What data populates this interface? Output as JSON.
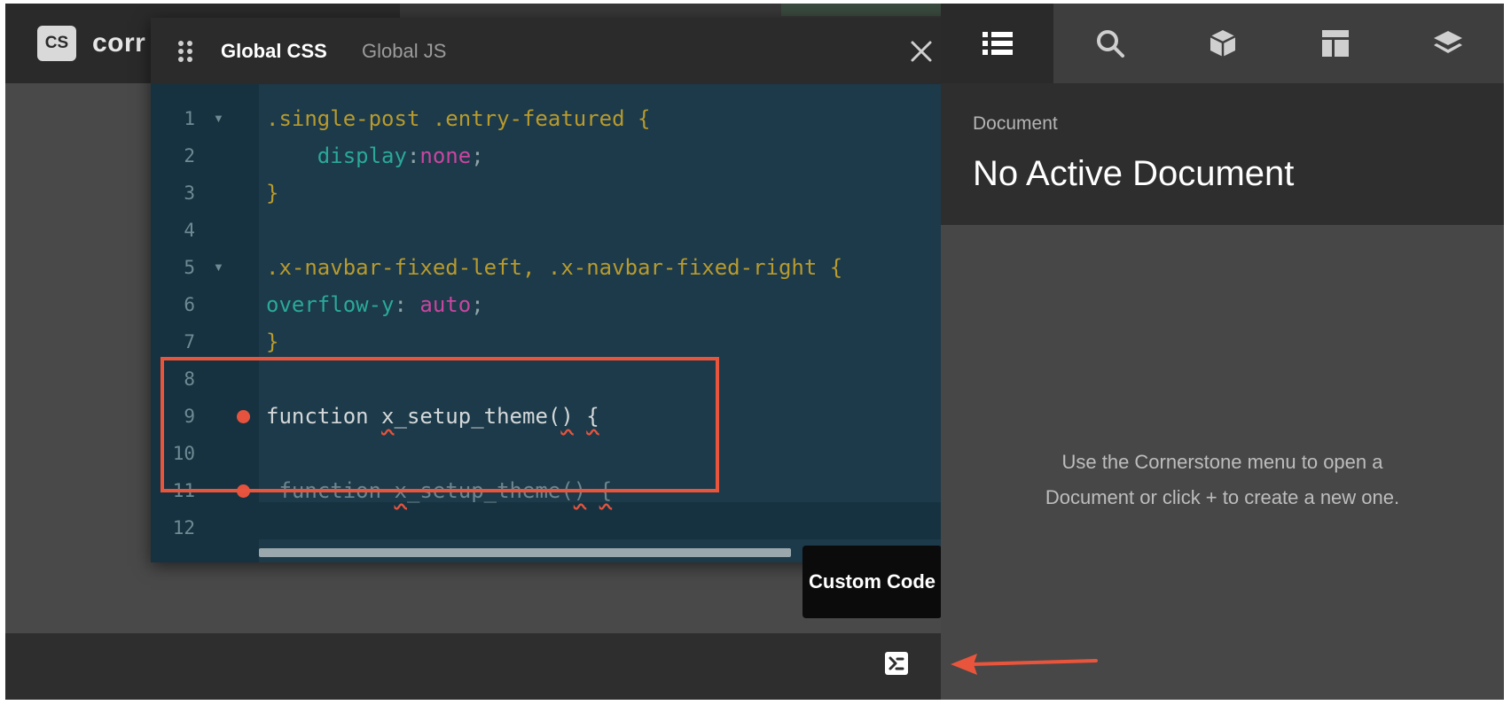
{
  "app": {
    "logo_text": "CS",
    "brand_text": "corr"
  },
  "editor": {
    "tabs": [
      {
        "label": "Global CSS",
        "active": true
      },
      {
        "label": "Global JS",
        "active": false
      }
    ],
    "lines": [
      {
        "n": "1",
        "fold": true,
        "parts": [
          {
            "t": ".single-post .entry-featured {",
            "c": "sel"
          }
        ]
      },
      {
        "n": "2",
        "parts": [
          {
            "t": "    display",
            "c": "prop"
          },
          {
            "t": ":",
            "c": "plain"
          },
          {
            "t": "none",
            "c": "val"
          },
          {
            "t": ";",
            "c": "plain"
          }
        ]
      },
      {
        "n": "3",
        "parts": [
          {
            "t": "}",
            "c": "sel"
          }
        ]
      },
      {
        "n": "4",
        "parts": []
      },
      {
        "n": "5",
        "fold": true,
        "parts": [
          {
            "t": ".x-navbar-fixed-left, .x-navbar-fixed-right {",
            "c": "sel"
          }
        ]
      },
      {
        "n": "6",
        "parts": [
          {
            "t": "overflow-y",
            "c": "prop"
          },
          {
            "t": ": ",
            "c": "plain"
          },
          {
            "t": "auto",
            "c": "val"
          },
          {
            "t": ";",
            "c": "plain"
          }
        ]
      },
      {
        "n": "7",
        "parts": [
          {
            "t": "}",
            "c": "sel"
          }
        ]
      },
      {
        "n": "8",
        "parts": []
      },
      {
        "n": "9",
        "error": true,
        "parts": [
          {
            "t": "function ",
            "c": "fn"
          },
          {
            "t": "x",
            "c": "fn squig"
          },
          {
            "t": "_setup_theme(",
            "c": "fn"
          },
          {
            "t": ")",
            "c": "fn squig"
          },
          {
            "t": " ",
            "c": "fn"
          },
          {
            "t": "{",
            "c": "fn squig"
          }
        ]
      },
      {
        "n": "10",
        "parts": []
      },
      {
        "n": "11",
        "error": true,
        "parts": [
          {
            "t": " function ",
            "c": "dim"
          },
          {
            "t": "x",
            "c": "dim squig"
          },
          {
            "t": "_setup_theme(",
            "c": "dim"
          },
          {
            "t": ")",
            "c": "dim squig"
          },
          {
            "t": " ",
            "c": "dim"
          },
          {
            "t": "{",
            "c": "dim squig"
          }
        ]
      },
      {
        "n": "12",
        "parts": []
      }
    ]
  },
  "tooltip": {
    "text": "Custom Code"
  },
  "right_panel": {
    "tabs": [
      {
        "icon": "list-icon",
        "active": true
      },
      {
        "icon": "search-icon",
        "active": false
      },
      {
        "icon": "cube-icon",
        "active": false
      },
      {
        "icon": "layout-icon",
        "active": false
      },
      {
        "icon": "layers-icon",
        "active": false
      }
    ],
    "doc_label": "Document",
    "doc_title": "No Active Document",
    "empty_message_line1": "Use the Cornerstone menu to open a",
    "empty_message_line2": "Document or click + to create a new one."
  },
  "colors": {
    "highlight": "#e8553c",
    "error_dot": "#e5533e"
  }
}
